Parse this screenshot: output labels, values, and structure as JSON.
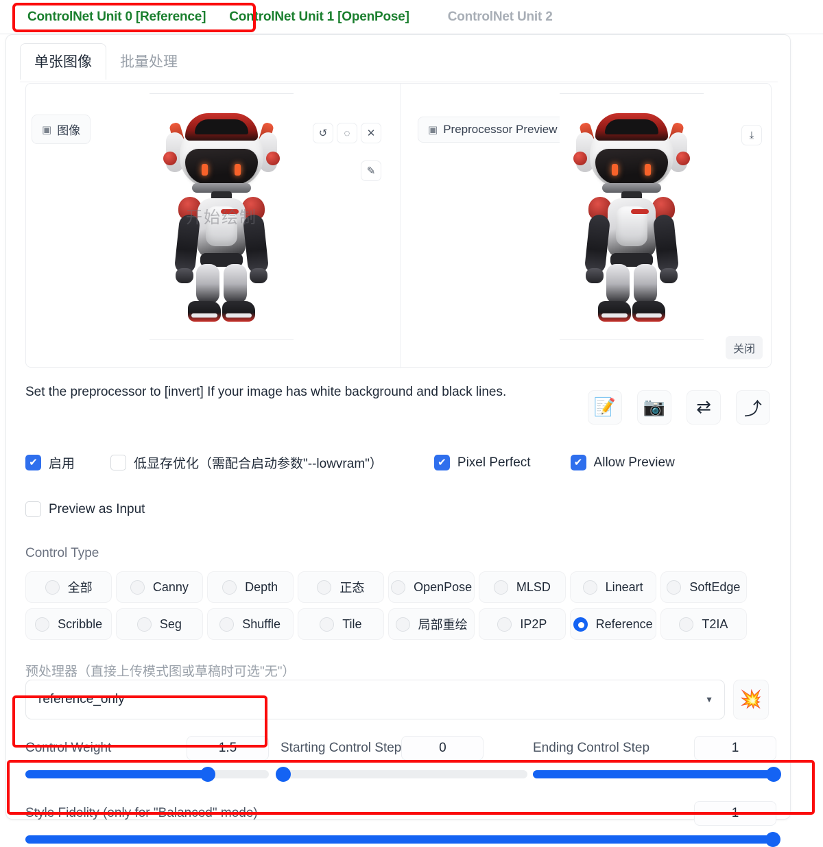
{
  "unit_tabs": [
    {
      "label": "ControlNet Unit 0 [Reference]",
      "state": "active"
    },
    {
      "label": "ControlNet Unit 1 [OpenPose]",
      "state": "done"
    },
    {
      "label": "ControlNet Unit 2",
      "state": "idle"
    }
  ],
  "sub_tabs": [
    {
      "label": "单张图像",
      "state": "active"
    },
    {
      "label": "批量处理",
      "state": "idle"
    }
  ],
  "image_panel": {
    "input_chip": {
      "icon": "image-icon",
      "label": "图像"
    },
    "preview_chip": {
      "icon": "image-icon",
      "label": "Preprocessor Preview"
    },
    "close_label": "关闭",
    "watermark": "开始绘制",
    "tools": [
      {
        "name": "undo-icon",
        "glyph": "↺"
      },
      {
        "name": "eraser-icon",
        "glyph": "◌"
      },
      {
        "name": "clear-icon",
        "glyph": "✕"
      },
      {
        "name": "brush-icon",
        "glyph": "✎"
      },
      {
        "name": "download-icon",
        "glyph": "⤓"
      }
    ]
  },
  "hint": "Set the preprocessor to [invert] If your image has white background and black lines.",
  "action_buttons": [
    {
      "name": "edit-prompt-button",
      "glyph": "📝"
    },
    {
      "name": "camera-button",
      "glyph": "📷"
    },
    {
      "name": "swap-button",
      "glyph": "⇄"
    },
    {
      "name": "send-up-button",
      "glyph": "⤴"
    }
  ],
  "checkboxes": {
    "row1": [
      {
        "label": "启用",
        "checked": true
      },
      {
        "label": "低显存优化（需配合启动参数\"--lowvram\"）",
        "checked": false
      },
      {
        "label": "Pixel Perfect",
        "checked": true
      },
      {
        "label": "Allow Preview",
        "checked": true
      }
    ],
    "row2": [
      {
        "label": "Preview as Input",
        "checked": false
      }
    ]
  },
  "control_type": {
    "label": "Control Type",
    "rows": [
      [
        {
          "label": "全部",
          "selected": false
        },
        {
          "label": "Canny",
          "selected": false
        },
        {
          "label": "Depth",
          "selected": false
        },
        {
          "label": "正态",
          "selected": false
        },
        {
          "label": "OpenPose",
          "selected": false
        },
        {
          "label": "MLSD",
          "selected": false
        },
        {
          "label": "Lineart",
          "selected": false
        },
        {
          "label": "SoftEdge",
          "selected": false
        }
      ],
      [
        {
          "label": "Scribble",
          "selected": false
        },
        {
          "label": "Seg",
          "selected": false
        },
        {
          "label": "Shuffle",
          "selected": false
        },
        {
          "label": "Tile",
          "selected": false
        },
        {
          "label": "局部重绘",
          "selected": false
        },
        {
          "label": "IP2P",
          "selected": false
        },
        {
          "label": "Reference",
          "selected": true
        },
        {
          "label": "T2IA",
          "selected": false
        }
      ]
    ]
  },
  "preprocessor": {
    "label": "预处理器（直接上传模式图或草稿时可选\"无\"）",
    "value": "reference_only",
    "caret": "▼",
    "run_glyph": "💥"
  },
  "sliders": [
    {
      "name": "control-weight",
      "label": "Control Weight",
      "value": "1.5",
      "percent": 75
    },
    {
      "name": "starting-control-step",
      "label": "Starting Control Step",
      "value": "0",
      "percent": 0
    },
    {
      "name": "ending-control-step",
      "label": "Ending Control Step",
      "value": "1",
      "percent": 100
    },
    {
      "name": "style-fidelity",
      "label": "Style Fidelity (only for \"Balanced\" mode)",
      "value": "1",
      "percent": 100
    }
  ],
  "colors": {
    "accent_blue": "#1463f3",
    "highlight_red": "#fb0b0b",
    "tab_green": "#1a7f2e",
    "tab_grey": "#a8aeb6"
  }
}
